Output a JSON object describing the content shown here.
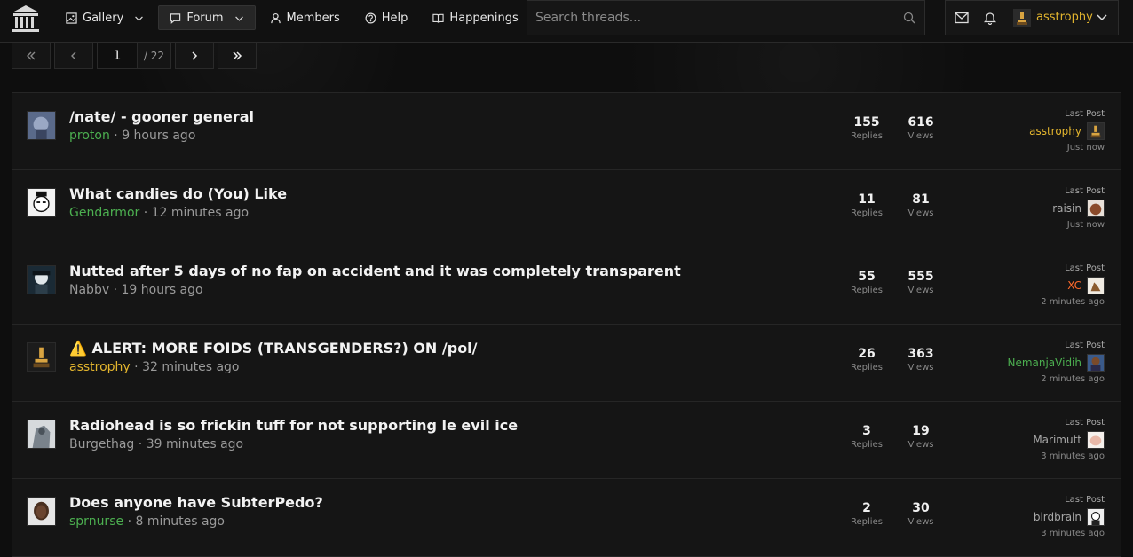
{
  "nav": {
    "items": [
      {
        "label": "Gallery",
        "icon": "image-icon",
        "dropdown": true
      },
      {
        "label": "Forum",
        "icon": "chat-icon",
        "dropdown": true,
        "active": true
      },
      {
        "label": "Members",
        "icon": "person-icon"
      },
      {
        "label": "Help",
        "icon": "question-icon"
      },
      {
        "label": "Happenings",
        "icon": "book-icon"
      }
    ],
    "search_placeholder": "Search threads...",
    "username": "asstrophy"
  },
  "pager": {
    "current": "1",
    "total_label": "/ 22"
  },
  "threads": [
    {
      "title": "/nate/ - gooner general",
      "author": "proton",
      "age": "9 hours ago",
      "replies": "155",
      "views": "616",
      "last_label": "Last Post",
      "last_user": "asstrophy",
      "last_time": "Just now"
    },
    {
      "title": "What candies do (You) Like",
      "author": "Gendarmor",
      "age": "12 minutes ago",
      "replies": "11",
      "views": "81",
      "last_label": "Last Post",
      "last_user": "raisin",
      "last_time": "Just now"
    },
    {
      "title": "Nutted after 5 days of no fap on accident and it was completely transparent",
      "author": "Nabbv",
      "age": "19 hours ago",
      "replies": "55",
      "views": "555",
      "last_label": "Last Post",
      "last_user": "XC",
      "last_time": "2 minutes ago"
    },
    {
      "title": "⚠️ ALERT: MORE FOIDS (TRANSGENDERS?) ON /pol/",
      "author": "asstrophy",
      "age": "32 minutes ago",
      "replies": "26",
      "views": "363",
      "last_label": "Last Post",
      "last_user": "NemanjaVidih",
      "last_time": "2 minutes ago"
    },
    {
      "title": "Radiohead is so frickin tuff for not supporting le evil ice",
      "author": "Burgethag",
      "age": "39 minutes ago",
      "replies": "3",
      "views": "19",
      "last_label": "Last Post",
      "last_user": "Marimutt",
      "last_time": "3 minutes ago"
    },
    {
      "title": "Does anyone have SubterPedo?",
      "author": "sprnurse",
      "age": "8 minutes ago",
      "replies": "2",
      "views": "30",
      "last_label": "Last Post",
      "last_user": "birdbrain",
      "last_time": "3 minutes ago"
    }
  ],
  "labels": {
    "replies": "Replies",
    "views": "Views",
    "sep": "·"
  },
  "colors": {
    "accent_gold": "#e3b52e",
    "user_green": "#4caf50",
    "user_orange": "#ff6a2b",
    "background": "#0e0e0e"
  }
}
